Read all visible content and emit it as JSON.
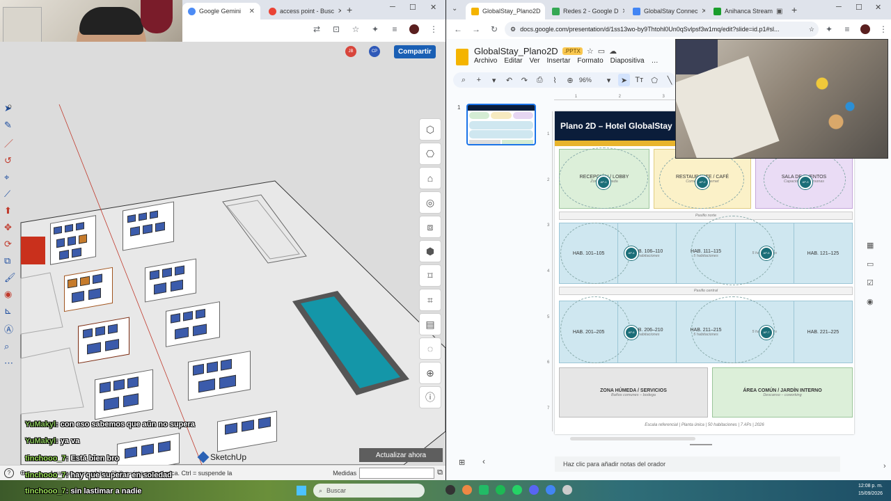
{
  "left_browser": {
    "tabs": [
      {
        "label": "Google Gemini",
        "color": "#4c8bf5"
      },
      {
        "label": "access point - Busc",
        "color": "#ea4335"
      }
    ],
    "new_tab": "+",
    "share_label": "Compartir",
    "avatars": [
      "JB",
      "CP"
    ]
  },
  "sketchup": {
    "app_name": "SketchUp",
    "update_button": "Actualizar ahora",
    "status_text": "Arrastrar para orbitar. Shift = vista panorámica. Ctrl = suspende la",
    "measures_label": "Medidas"
  },
  "chat": [
    {
      "user": "YuMakyl",
      "text": ": con eso sabemos que aún no supera"
    },
    {
      "user": "YuMakyl",
      "text": ": ya va"
    },
    {
      "user": "tinchooo_7",
      "text": ": Está bien bro"
    },
    {
      "user": "tinchooo_7",
      "text": ": hay que superar en soledad"
    },
    {
      "user": "tinchooo_7",
      "text": ": sin lastimar a nadie"
    }
  ],
  "right_browser": {
    "tabs": [
      {
        "label": "GlobalStay_Plano2D",
        "color": "#f4b400"
      },
      {
        "label": "Redes 2 - Google D",
        "color": "#34a853"
      },
      {
        "label": "GlobalStay Connec",
        "color": "#4285f4"
      },
      {
        "label": "Anihanca Stream",
        "color": "#1a9e2c"
      }
    ],
    "url": "docs.google.com/presentation/d/1ss13wo-by9Thtohl0Un0qSvlpsf3w1mq/edit?slide=id.p1#sl..."
  },
  "slides": {
    "title": "GlobalStay_Plano2D",
    "badge": ".PPTX",
    "menu": [
      "Archivo",
      "Editar",
      "Ver",
      "Insertar",
      "Formato",
      "Diapositiva"
    ],
    "zoom": "96%",
    "thumb_number": "1",
    "notes_placeholder": "Haz clic para añadir notas del orador",
    "slide": {
      "title": "Plano 2D – Hotel GlobalStay",
      "top_zones": [
        {
          "label": "RECEPCIÓN / LOBBY",
          "sub": "Zona de llegada"
        },
        {
          "label": "RESTAURANTE / CAFÉ",
          "sub": "Comedor – Internet"
        },
        {
          "label": "SALA DE EVENTOS",
          "sub": "Capacidad 50 personas"
        }
      ],
      "corridor_north": "Pasillo norte",
      "corridor_central": "Pasillo central",
      "rooms_row1": [
        {
          "label": "HAB. 101–105",
          "sub": ""
        },
        {
          "label": "HAB. 106–110",
          "sub": "5 habitaciones"
        },
        {
          "label": "HAB. 111–115",
          "sub": "5 habitaciones"
        },
        {
          "label": "",
          "sub": "5 habitaciones"
        },
        {
          "label": "HAB. 121–125",
          "sub": ""
        }
      ],
      "rooms_row2": [
        {
          "label": "HAB. 201–205",
          "sub": ""
        },
        {
          "label": "HAB. 206–210",
          "sub": "5 habitaciones"
        },
        {
          "label": "HAB. 211–215",
          "sub": "5 habitaciones"
        },
        {
          "label": "",
          "sub": "5 habitaciones"
        },
        {
          "label": "HAB. 221–225",
          "sub": ""
        }
      ],
      "bottom_zones": [
        {
          "label": "ZONA HÚMEDA / SERVICIOS",
          "sub": "Baños comunes – bodega"
        },
        {
          "label": "ÁREA COMÚN / JARDÍN INTERNO",
          "sub": "Descanso – coworking"
        }
      ],
      "footer": "Escala referencial | Planta única | 50 habitaciones | 7 APs | 2026",
      "ap_labels": [
        "AP-1",
        "AP-2",
        "AP-3",
        "AP-4",
        "AP-5",
        "AP-6",
        "AP-7"
      ]
    }
  },
  "taskbar": {
    "search_placeholder": "Buscar",
    "time": "12:08 p. m.",
    "date": "15/09/2026"
  }
}
